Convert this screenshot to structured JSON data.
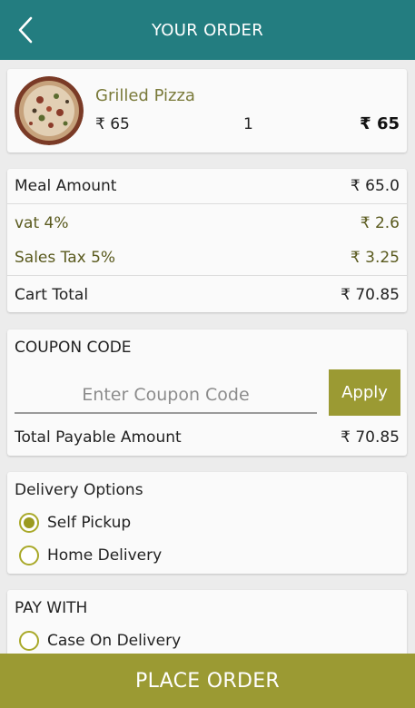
{
  "header": {
    "title": "YOUR ORDER",
    "back_icon": "chevron-left-icon",
    "color": "#237d80"
  },
  "cart_item": {
    "name": "Grilled Pizza",
    "price": "₹ 65",
    "quantity": "1",
    "line_total": "₹ 65"
  },
  "summary": {
    "meal_amount": {
      "label": "Meal Amount",
      "value": "₹ 65.0"
    },
    "vat": {
      "label": "vat 4%",
      "value": "₹ 2.6"
    },
    "sales_tax": {
      "label": "Sales Tax 5%",
      "value": "₹ 3.25"
    },
    "cart_total": {
      "label": "Cart Total",
      "value": "₹ 70.85"
    }
  },
  "coupon": {
    "title": "COUPON CODE",
    "placeholder": "Enter Coupon Code",
    "value": "",
    "apply_label": "Apply",
    "payable_label": "Total Payable Amount",
    "payable_value": "₹ 70.85"
  },
  "delivery": {
    "title": "Delivery Options",
    "options": [
      {
        "label": "Self Pickup",
        "selected": true
      },
      {
        "label": "Home Delivery",
        "selected": false
      }
    ]
  },
  "payment": {
    "title": "PAY WITH",
    "options": [
      {
        "label": "Case On Delivery",
        "selected": false
      }
    ]
  },
  "place_order_label": "PLACE ORDER",
  "accent_color": "#9b9a33"
}
